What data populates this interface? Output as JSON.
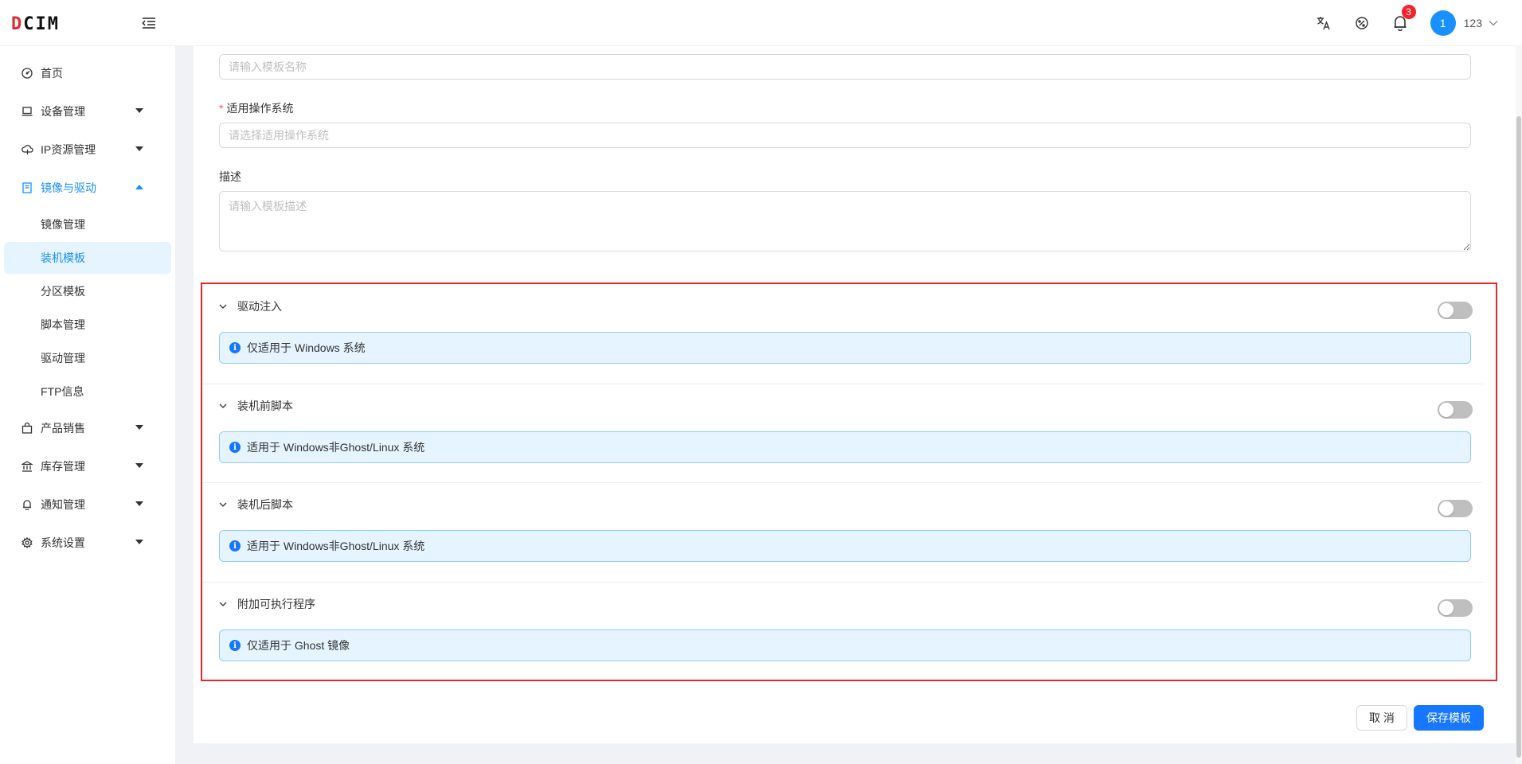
{
  "app": {
    "logo_prefix": "D",
    "logo_rest": "CIM"
  },
  "header": {
    "notification_count": "3",
    "user": {
      "avatar_text": "1",
      "name": "123"
    }
  },
  "sidebar": {
    "items": [
      {
        "label": "首页",
        "icon": "dashboard-icon"
      },
      {
        "label": "设备管理",
        "icon": "laptop-icon"
      },
      {
        "label": "IP资源管理",
        "icon": "cloud-icon"
      },
      {
        "label": "镜像与驱动",
        "icon": "book-icon"
      },
      {
        "label": "产品销售",
        "icon": "shopping-bag-icon"
      },
      {
        "label": "库存管理",
        "icon": "bank-icon"
      },
      {
        "label": "通知管理",
        "icon": "bell-icon"
      },
      {
        "label": "系统设置",
        "icon": "gear-icon"
      }
    ],
    "submenu": [
      "镜像管理",
      "装机模板",
      "分区模板",
      "脚本管理",
      "驱动管理",
      "FTP信息"
    ],
    "selected_submenu": "装机模板"
  },
  "form": {
    "name_placeholder": "请输入模板名称",
    "os_label": "适用操作系统",
    "os_placeholder": "请选择适用操作系统",
    "desc_label": "描述",
    "desc_placeholder": "请输入模板描述"
  },
  "sections": [
    {
      "title": "驱动注入",
      "note": "仅适用于 Windows 系统",
      "enabled": false
    },
    {
      "title": "装机前脚本",
      "note": "适用于 Windows非Ghost/Linux 系统",
      "enabled": false
    },
    {
      "title": "装机后脚本",
      "note": "适用于 Windows非Ghost/Linux 系统",
      "enabled": false
    },
    {
      "title": "附加可执行程序",
      "note": "仅适用于 Ghost 镜像",
      "enabled": false
    }
  ],
  "buttons": {
    "cancel": "取 消",
    "save": "保存模板"
  },
  "colors": {
    "primary": "#1677ff",
    "highlight_border": "#e8272a",
    "info_bg": "#e6f4ff"
  }
}
